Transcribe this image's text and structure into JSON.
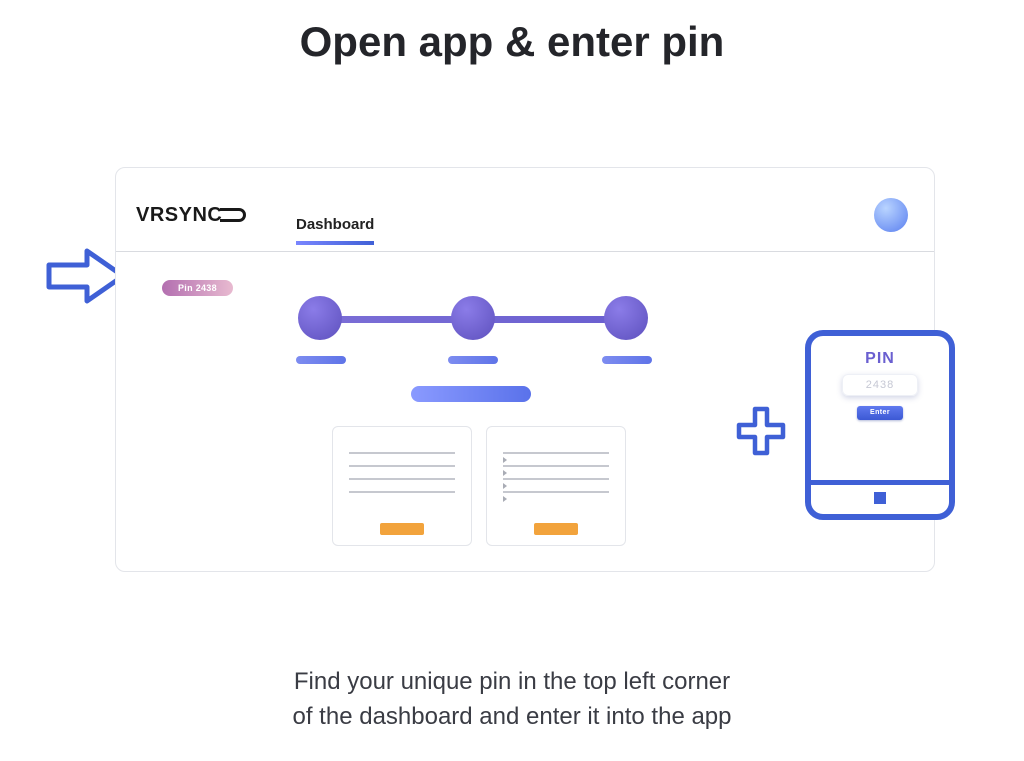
{
  "title": "Open app & enter pin",
  "caption_line1": "Find your unique pin in the top left corner",
  "caption_line2": "of the dashboard and enter it into the app",
  "logo": {
    "vr": "VR",
    "sync": "SYNC"
  },
  "tab": "Dashboard",
  "pin_badge": "Pin 2438",
  "phone": {
    "label": "PIN",
    "placeholder": "2438",
    "enter": "Enter"
  },
  "colors": {
    "accent_blue": "#3f60d6",
    "accent_purple": "#6a5fd0",
    "orange": "#f2a33c",
    "pink": "#e8bad0"
  }
}
